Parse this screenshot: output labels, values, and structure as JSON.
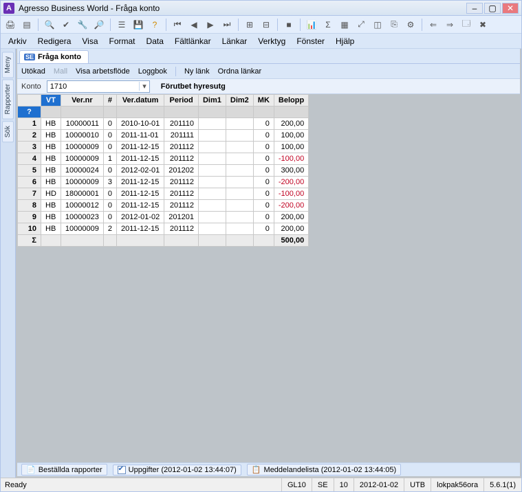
{
  "window": {
    "title": "Agresso Business World - Fråga konto"
  },
  "menubar": [
    "Arkiv",
    "Redigera",
    "Visa",
    "Format",
    "Data",
    "Fältlänkar",
    "Länkar",
    "Verktyg",
    "Fönster",
    "Hjälp"
  ],
  "sideTabs": [
    "Meny",
    "Rapporter",
    "Sök"
  ],
  "docTab": {
    "badge": "SE",
    "label": "Fråga konto"
  },
  "subtoolbar": {
    "utokad": "Utökad",
    "mall": "Mall",
    "visa": "Visa arbetsflöde",
    "loggbok": "Loggbok",
    "nylank": "Ny länk",
    "ordna": "Ordna länkar"
  },
  "konto": {
    "label": "Konto",
    "value": "1710",
    "desc": "Förutbet hyresutg"
  },
  "grid": {
    "headers": [
      "",
      "VT",
      "Ver.nr",
      "#",
      "Ver.datum",
      "Period",
      "Dim1",
      "Dim2",
      "MK",
      "Belopp"
    ],
    "filterlabel": "?",
    "rows": [
      {
        "n": "1",
        "vt": "HB",
        "ver": "10000011",
        "hash": "0",
        "dat": "2010-10-01",
        "per": "201110",
        "d1": "",
        "d2": "",
        "mk": "0",
        "bel": "200,00",
        "neg": false
      },
      {
        "n": "2",
        "vt": "HB",
        "ver": "10000010",
        "hash": "0",
        "dat": "2011-11-01",
        "per": "201111",
        "d1": "",
        "d2": "",
        "mk": "0",
        "bel": "100,00",
        "neg": false
      },
      {
        "n": "3",
        "vt": "HB",
        "ver": "10000009",
        "hash": "0",
        "dat": "2011-12-15",
        "per": "201112",
        "d1": "",
        "d2": "",
        "mk": "0",
        "bel": "100,00",
        "neg": false
      },
      {
        "n": "4",
        "vt": "HB",
        "ver": "10000009",
        "hash": "1",
        "dat": "2011-12-15",
        "per": "201112",
        "d1": "",
        "d2": "",
        "mk": "0",
        "bel": "-100,00",
        "neg": true
      },
      {
        "n": "5",
        "vt": "HB",
        "ver": "10000024",
        "hash": "0",
        "dat": "2012-02-01",
        "per": "201202",
        "d1": "",
        "d2": "",
        "mk": "0",
        "bel": "300,00",
        "neg": false
      },
      {
        "n": "6",
        "vt": "HB",
        "ver": "10000009",
        "hash": "3",
        "dat": "2011-12-15",
        "per": "201112",
        "d1": "",
        "d2": "",
        "mk": "0",
        "bel": "-200,00",
        "neg": true
      },
      {
        "n": "7",
        "vt": "HD",
        "ver": "18000001",
        "hash": "0",
        "dat": "2011-12-15",
        "per": "201112",
        "d1": "",
        "d2": "",
        "mk": "0",
        "bel": "-100,00",
        "neg": true
      },
      {
        "n": "8",
        "vt": "HB",
        "ver": "10000012",
        "hash": "0",
        "dat": "2011-12-15",
        "per": "201112",
        "d1": "",
        "d2": "",
        "mk": "0",
        "bel": "-200,00",
        "neg": true
      },
      {
        "n": "9",
        "vt": "HB",
        "ver": "10000023",
        "hash": "0",
        "dat": "2012-01-02",
        "per": "201201",
        "d1": "",
        "d2": "",
        "mk": "0",
        "bel": "200,00",
        "neg": false
      },
      {
        "n": "10",
        "vt": "HB",
        "ver": "10000009",
        "hash": "2",
        "dat": "2011-12-15",
        "per": "201112",
        "d1": "",
        "d2": "",
        "mk": "0",
        "bel": "200,00",
        "neg": false
      }
    ],
    "sum": {
      "label": "Σ",
      "bel": "500,00"
    }
  },
  "bottomTabs": {
    "bestallda": "Beställda rapporter",
    "uppgifter": "Uppgifter (2012-01-02 13:44:07)",
    "meddel": "Meddelandelista (2012-01-02 13:44:05)"
  },
  "status": {
    "ready": "Ready",
    "gl": "GL10",
    "se": "SE",
    "ten": "10",
    "date": "2012-01-02",
    "utb": "UTB",
    "lok": "lokpak56ora",
    "ver": "5.6.1(1)"
  }
}
